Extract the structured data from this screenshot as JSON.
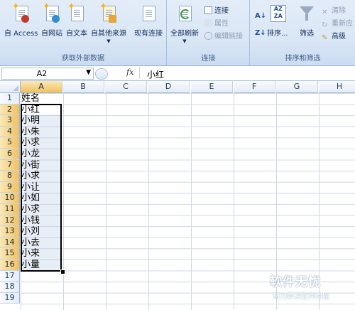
{
  "ribbon": {
    "groups": {
      "external_data": "获取外部数据",
      "connections": "连接",
      "sort_filter": "排序和筛选"
    },
    "buttons": {
      "from_access": "自 Access",
      "from_web": "自网站",
      "from_text": "自文本",
      "from_other": "自其他来源",
      "existing_connections": "现有连接",
      "refresh_all": "全部刷新",
      "connections": "连接",
      "properties": "属性",
      "edit_links": "编辑链接",
      "sort": "排序...",
      "filter": "筛选",
      "clear": "清除",
      "reapply": "重新应",
      "advanced": "高级"
    }
  },
  "formula_bar": {
    "name_box": "A2",
    "fx_label": "fx",
    "formula": "小红"
  },
  "grid": {
    "columns": [
      "A",
      "B",
      "C",
      "D",
      "E",
      "F",
      "G",
      "H"
    ],
    "rows": [
      "1",
      "2",
      "3",
      "4",
      "5",
      "6",
      "7",
      "8",
      "9",
      "10",
      "11",
      "12",
      "13",
      "14",
      "15",
      "16",
      "17",
      "18",
      "19"
    ],
    "column_a_values": [
      "姓名",
      "小红",
      "小明",
      "小朱",
      "小求",
      "小龙",
      "小街",
      "小求",
      "小让",
      "小如",
      "小求",
      "小钱",
      "小刘",
      "小去",
      "小来",
      "小量"
    ]
  },
  "watermark": {
    "title": "软件无忧",
    "subtitle": "努力解决软件问题"
  },
  "colors": {
    "ribbon_bg": "#dbe7f6",
    "selection_header": "#f1c15f",
    "gridline": "#d0d7e5"
  }
}
